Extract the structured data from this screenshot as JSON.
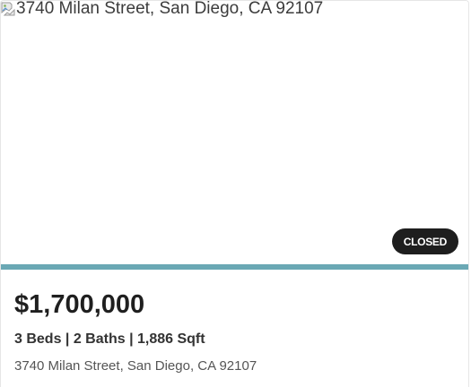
{
  "listing": {
    "photo_alt": "3740 Milan Street, San Diego, CA 92107",
    "status": "CLOSED",
    "price": "$1,700,000",
    "specs": "3 Beds | 2 Baths | 1,886 Sqft",
    "address": "3740 Milan Street, San Diego, CA 92107"
  },
  "colors": {
    "accent": "#6aa8b4",
    "badge_bg": "#1e1e1e",
    "badge_text": "#ffffff",
    "price_text": "#1f1f1f"
  },
  "icons": {
    "photo_placeholder": "broken-image-icon"
  }
}
